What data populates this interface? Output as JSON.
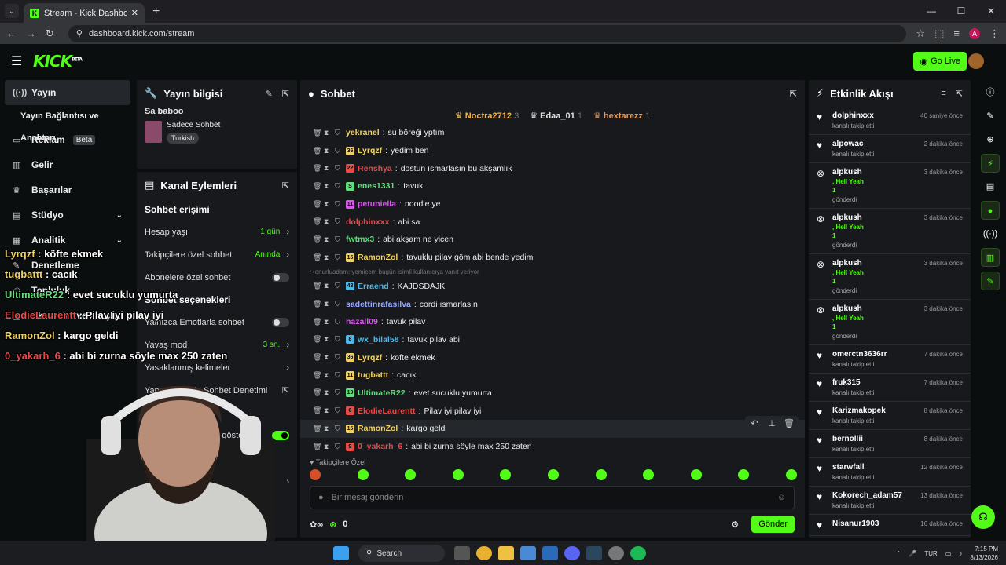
{
  "browser": {
    "tab_title": "Stream - Kick Dashboard",
    "url": "dashboard.kick.com/stream",
    "profile_initial": "A"
  },
  "topnav": {
    "logo": "KICK",
    "beta": "BETA",
    "go_live": "Go Live"
  },
  "sidebar": {
    "items": [
      {
        "label": "Yayın",
        "icon": "broadcast-icon"
      },
      {
        "label": "Yayın Bağlantısı ve Anahtarı"
      },
      {
        "label": "Reklam",
        "badge": "Beta",
        "icon": "ad-icon"
      },
      {
        "label": "Gelir",
        "icon": "money-icon"
      },
      {
        "label": "Başarılar",
        "icon": "trophy-icon"
      },
      {
        "label": "Stüdyo",
        "icon": "studio-icon"
      },
      {
        "label": "Analitik",
        "icon": "analytics-icon"
      },
      {
        "label": "Denetleme",
        "icon": "tool-icon"
      },
      {
        "label": "Topluluk"
      },
      {
        "label": "Eklentiler ve Araçlar"
      }
    ]
  },
  "info_panel": {
    "title": "Yayın bilgisi",
    "stream_title": "Sa baboo",
    "category": "Sadece Sohbet",
    "tag": "Turkish"
  },
  "channel_panel": {
    "title": "Kanal Eylemleri",
    "sec1": "Sohbet erişimi",
    "account_age": {
      "label": "Hesap yaşı",
      "value": "1 gün"
    },
    "followers_only": {
      "label": "Takipçilere özel sohbet",
      "value": "Anında"
    },
    "subs_only": {
      "label": "Abonelere özel sohbet"
    },
    "sec2": "Sohbet seçenekleri",
    "emote_only": {
      "label": "Yalnızca Emotlarla sohbet"
    },
    "slow_mode": {
      "label": "Yavaş mod",
      "value": "3 sn."
    },
    "banned_words": {
      "label": "Yasaklanmış kelimeler"
    },
    "ai_mod": {
      "label": "Yapay Zeka ile Sohbet Denetimi"
    },
    "sec3": "Tercihler",
    "show_option": {
      "label": "Zaman damgalarını göster"
    }
  },
  "chat": {
    "title": "Sohbet",
    "top": [
      {
        "name": "Noctra2712",
        "count": "3",
        "color": "#f5b642"
      },
      {
        "name": "Edaa_01",
        "count": "1",
        "color": "#e0e0e0"
      },
      {
        "name": "hextarezz",
        "count": "1",
        "color": "#e39a5a"
      }
    ],
    "messages": [
      {
        "user": "yekranel",
        "text": "su böreği yptım",
        "color": "#f0d264",
        "badge": ""
      },
      {
        "user": "Lyrqzf",
        "text": "yedim ben",
        "color": "#f0d264",
        "badge": "36"
      },
      {
        "user": "Renshya",
        "text": "dostun ısmarlasın bu akşamlık",
        "color": "#e84a4a",
        "badge": "22"
      },
      {
        "user": "enes1331",
        "text": "tavuk",
        "color": "#5ee07a",
        "badge": "S"
      },
      {
        "user": "petuniella",
        "text": "noodle ye",
        "color": "#d65ae8",
        "badge": "11"
      },
      {
        "user": "dolphinxxx",
        "text": "abi sa",
        "color": "#e84a4a",
        "badge": ""
      },
      {
        "user": "fwtmx3",
        "text": "abi akşam ne yicen",
        "color": "#5ee07a",
        "badge": ""
      },
      {
        "user": "RamonZol",
        "text": "tavuklu pilav göm abi bende yedim",
        "color": "#f0d264",
        "badge": "15"
      }
    ],
    "reply_note": "onurluadam: yemicem bugün isimli kullanıcıya yanıt veriyor",
    "messages2": [
      {
        "user": "Erraend",
        "text": "KAJDSDAJK",
        "color": "#4ab8e8",
        "badge": "43"
      },
      {
        "user": "sadettinrafasilva",
        "text": "cordi ısmarlasın",
        "color": "#9aa8ff",
        "badge": ""
      },
      {
        "user": "hazall09",
        "text": "tavuk pilav",
        "color": "#d65ae8",
        "badge": ""
      },
      {
        "user": "wx_bilal58",
        "text": "tavuk pilav abi",
        "color": "#4ab8e8",
        "badge": "8"
      },
      {
        "user": "Lyrqzf",
        "text": "köfte ekmek",
        "color": "#f0d264",
        "badge": "36"
      },
      {
        "user": "tugbattt",
        "text": "cacık",
        "color": "#f0d264",
        "badge": "11"
      },
      {
        "user": "UltimateR22",
        "text": "evet sucuklu yumurta",
        "color": "#5ee07a",
        "badge": "19"
      },
      {
        "user": "ElodieLaurentt",
        "text": "Pilav iyi pilav iyi",
        "color": "#e84a4a",
        "badge": "6"
      },
      {
        "user": "RamonZol",
        "text": "kargo geldi",
        "color": "#f0d264",
        "badge": "15"
      },
      {
        "user": "0_yakarh_6",
        "text": "abi bi zurna söyle max 250 zaten",
        "color": "#e84a4a",
        "badge": "S"
      }
    ],
    "followers_only": "Takipçilere Özel",
    "placeholder": "Bir mesaj gönderin",
    "points": "0",
    "send": "Gönder"
  },
  "activity": {
    "title": "Etkinlik Akışı",
    "events": [
      {
        "name": "dolphinxxx",
        "sub": "kanalı takip etti",
        "time": "40 saniye önce",
        "type": "follow"
      },
      {
        "name": "alpowac",
        "sub": "kanalı takip etti",
        "time": "2 dakika önce",
        "type": "follow"
      },
      {
        "name": "alpkush",
        "gift": ", Hell Yeah",
        "count": "1",
        "sub": "gönderdi",
        "time": "3 dakika önce",
        "type": "gift"
      },
      {
        "name": "alpkush",
        "gift": ", Hell Yeah",
        "count": "1",
        "sub": "gönderdi",
        "time": "3 dakika önce",
        "type": "gift"
      },
      {
        "name": "alpkush",
        "gift": ", Hell Yeah",
        "count": "1",
        "sub": "gönderdi",
        "time": "3 dakika önce",
        "type": "gift"
      },
      {
        "name": "alpkush",
        "gift": ", Hell Yeah",
        "count": "1",
        "sub": "gönderdi",
        "time": "3 dakika önce",
        "type": "gift"
      },
      {
        "name": "omerctn3636rr",
        "sub": "kanalı takip etti",
        "time": "7 dakika önce",
        "type": "follow"
      },
      {
        "name": "fruk315",
        "sub": "kanalı takip etti",
        "time": "7 dakika önce",
        "type": "follow"
      },
      {
        "name": "Karizmakopek",
        "sub": "kanalı takip etti",
        "time": "8 dakika önce",
        "type": "follow"
      },
      {
        "name": "bernollii",
        "sub": "kanalı takip etti",
        "time": "8 dakika önce",
        "type": "follow"
      },
      {
        "name": "starwfall",
        "sub": "kanalı takip etti",
        "time": "12 dakika önce",
        "type": "follow"
      },
      {
        "name": "Kokorech_adam57",
        "sub": "kanalı takip etti",
        "time": "13 dakika önce",
        "type": "follow"
      },
      {
        "name": "Nisanur1903",
        "sub": "",
        "time": "16 dakika önce",
        "type": "follow"
      }
    ]
  },
  "overlay": [
    {
      "user": "Lyrqzf",
      "text": " : köfte ekmek",
      "color": "#f0d264"
    },
    {
      "user": "tugbattt",
      "text": " : cacık",
      "color": "#f0d264"
    },
    {
      "user": "UltimateR22",
      "text": " : evet sucuklu yumurta",
      "color": "#5ee07a"
    },
    {
      "user": "ElodieLaurentt",
      "text": " : Pilav iyi pilav iyi",
      "color": "#e84a4a"
    },
    {
      "user": "RamonZol",
      "text": " : kargo geldi",
      "color": "#f0d264"
    },
    {
      "user": "0_yakarh_6",
      "text": " : abi bi zurna söyle max 250 zaten",
      "color": "#e84a4a"
    }
  ],
  "taskbar": {
    "search": "Search",
    "lang": "TUR",
    "time": "7:15 PM",
    "date": "8/13/2026"
  }
}
